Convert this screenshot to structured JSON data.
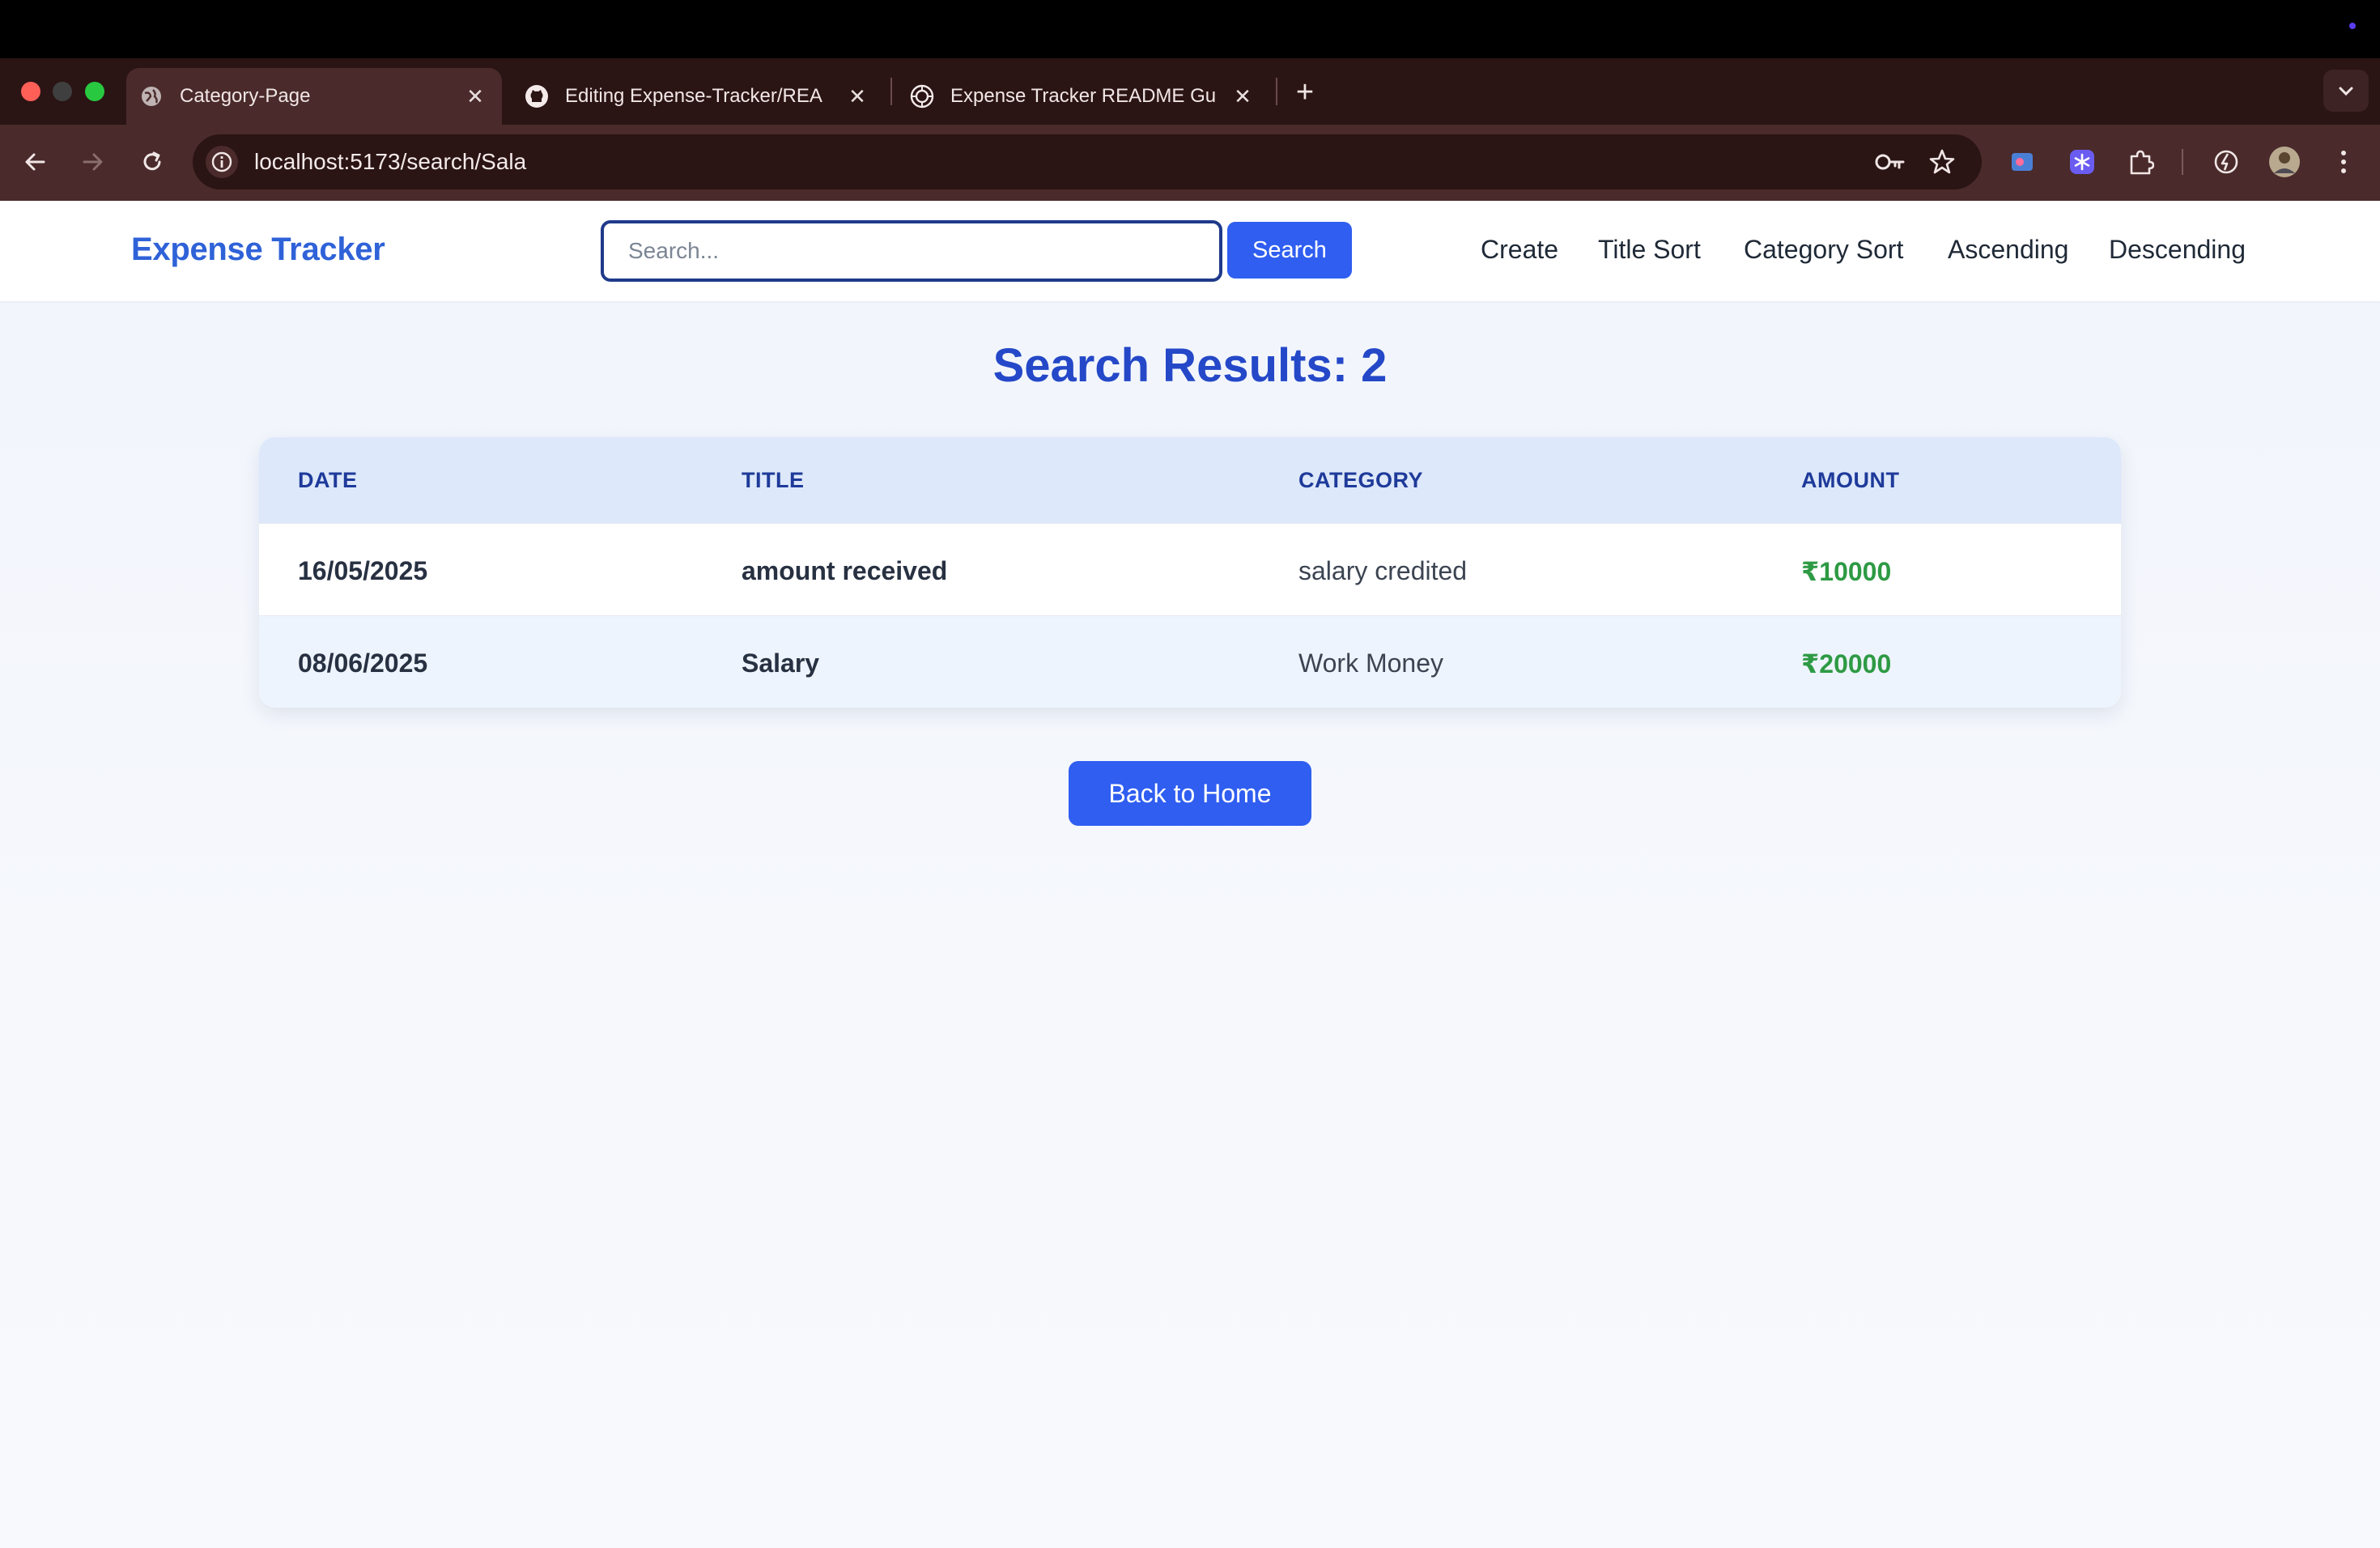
{
  "browser": {
    "tabs": [
      {
        "label": "Category-Page",
        "icon": "globe-icon",
        "active": true
      },
      {
        "label": "Editing Expense-Tracker/REA",
        "icon": "github-icon",
        "active": false
      },
      {
        "label": "Expense Tracker README Gu",
        "icon": "openai-icon",
        "active": false
      }
    ],
    "url": "localhost:5173/search/Sala"
  },
  "app": {
    "brand": "Expense Tracker",
    "search": {
      "placeholder": "Search...",
      "value": "",
      "button_label": "Search"
    },
    "nav_links": [
      "Create",
      "Title Sort",
      "Category Sort",
      "Ascending",
      "Descending"
    ]
  },
  "results": {
    "heading": "Search Results: 2",
    "columns": [
      "DATE",
      "TITLE",
      "CATEGORY",
      "AMOUNT"
    ],
    "rows": [
      {
        "date": "16/05/2025",
        "title": "amount received",
        "category": "salary credited",
        "amount": "₹10000"
      },
      {
        "date": "08/06/2025",
        "title": "Salary",
        "category": "Work Money",
        "amount": "₹20000"
      }
    ],
    "back_button": "Back to Home"
  },
  "colors": {
    "brand": "#2f62d8",
    "primary_button": "#2f5ef0",
    "heading": "#2448c8",
    "amount": "#2e9a44",
    "table_header_bg": "#dde8fa"
  }
}
